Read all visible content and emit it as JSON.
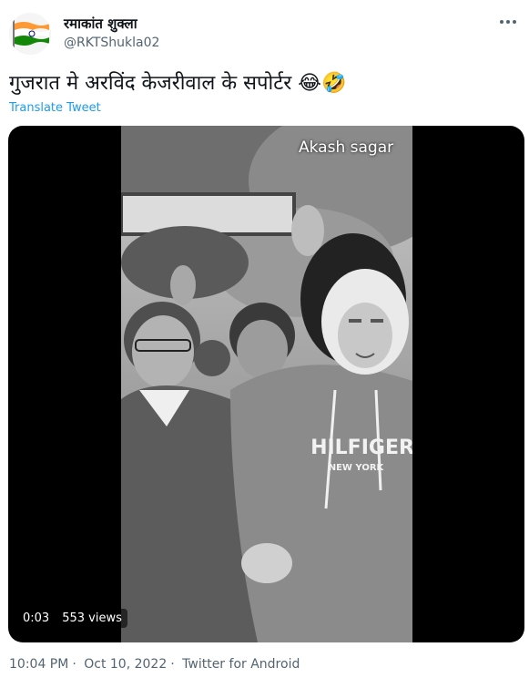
{
  "author": {
    "display_name": "रमाकांत शुक्ला",
    "handle": "@RKTShukla02",
    "avatar_icon": "indian-flag-icon"
  },
  "more_icon": "more-options-icon",
  "tweet": {
    "text": "गुजरात मे अरविंद केजरीवाल के सपोर्टर 😂🤣",
    "translate_label": "Translate Tweet"
  },
  "video": {
    "watermark": "Akash sagar",
    "sweatshirt_text": "HILFIGER",
    "sweatshirt_subtext": "NEW YORK",
    "time": "0:03",
    "views": "553 views"
  },
  "meta": {
    "time": "10:04 PM",
    "separator": "·",
    "date": "Oct 10, 2022",
    "source": "Twitter for Android"
  },
  "colors": {
    "link": "#1d9bf0",
    "secondary_text": "#536471",
    "primary_text": "#0f1419",
    "saffron": "#ff9933",
    "green": "#138808",
    "navy": "#000080"
  }
}
